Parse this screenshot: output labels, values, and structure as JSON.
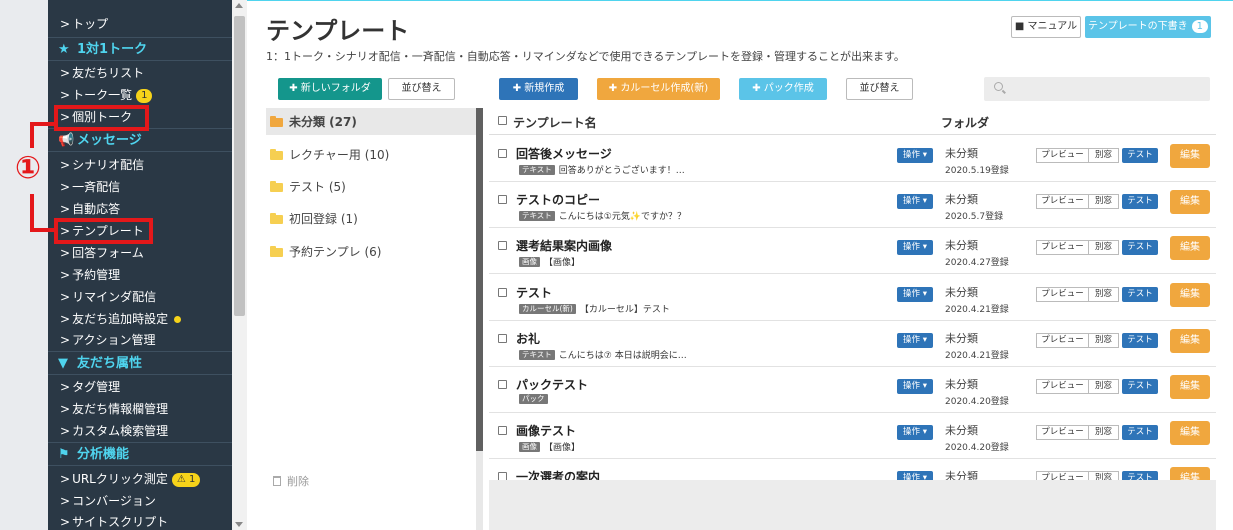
{
  "sidebar": {
    "items": [
      {
        "label": "トップ"
      },
      {
        "label": "1対1トーク",
        "heading": true,
        "icon": "star-icon"
      },
      {
        "label": "友だちリスト"
      },
      {
        "label": "トーク一覧",
        "badge": "1"
      },
      {
        "label": "個別トーク"
      },
      {
        "label": "メッセージ",
        "heading": true,
        "icon": "megaphone-icon"
      },
      {
        "label": "シナリオ配信"
      },
      {
        "label": "一斉配信"
      },
      {
        "label": "自動応答"
      },
      {
        "label": "テンプレート"
      },
      {
        "label": "回答フォーム"
      },
      {
        "label": "予約管理"
      },
      {
        "label": "リマインダ配信"
      },
      {
        "label": "友だち追加時設定"
      },
      {
        "label": "アクション管理"
      },
      {
        "label": "友だち属性",
        "heading": true,
        "icon": "filter-icon"
      },
      {
        "label": "タグ管理"
      },
      {
        "label": "友だち情報欄管理"
      },
      {
        "label": "カスタム検索管理"
      },
      {
        "label": "分析機能",
        "heading": true,
        "icon": "flag-icon"
      },
      {
        "label": "URLクリック測定",
        "warn_badge": "1"
      },
      {
        "label": "コンバージョン"
      },
      {
        "label": "サイトスクリプト"
      }
    ]
  },
  "annotation": {
    "number": "①"
  },
  "header": {
    "title": "テンプレート",
    "description": "1：1トーク・シナリオ配信・一斉配信・自動応答・リマインダなどで使用できるテンプレートを登録・管理することが出来ます。",
    "manual_label": "マニュアル",
    "draft_label": "テンプレートの下書き",
    "draft_count": "1"
  },
  "toolbar": {
    "new_folder": "新しいフォルダ",
    "sort_folders": "並び替え",
    "new_create": "新規作成",
    "carousel_create": "カルーセル作成(新)",
    "pack_create": "パック作成",
    "sort_templates": "並び替え",
    "search_placeholder": ""
  },
  "folders": [
    {
      "label": "未分類 (27)",
      "selected": true
    },
    {
      "label": "レクチャー用 (10)"
    },
    {
      "label": "テスト (5)"
    },
    {
      "label": "初回登録 (1)"
    },
    {
      "label": "予約テンプレ (6)"
    }
  ],
  "delete_label": "削除",
  "table": {
    "col_name": "テンプレート名",
    "col_folder": "フォルダ",
    "ops_label": "操作",
    "preview_label": "プレビュー",
    "new_window_label": "別窓",
    "test_label": "テスト",
    "edit_label": "編集",
    "rows": [
      {
        "name": "回答後メッセージ",
        "tag": "テキスト",
        "preview": "回答ありがとうございます！…",
        "folder": "未分類",
        "date": "2020.5.19登録"
      },
      {
        "name": "テストのコピー",
        "tag": "テキスト",
        "preview": "こんにちは①元気✨ですか？？",
        "folder": "未分類",
        "date": "2020.5.7登録"
      },
      {
        "name": "選考結果案内画像",
        "tag": "画像",
        "preview": "【画像】",
        "folder": "未分類",
        "date": "2020.4.27登録"
      },
      {
        "name": "テスト",
        "tag": "カルーセル(新)",
        "preview": "【カルーセル】テスト",
        "folder": "未分類",
        "date": "2020.4.21登録"
      },
      {
        "name": "お礼",
        "tag": "テキスト",
        "preview": "こんにちは⑦ 本日は説明会に…",
        "folder": "未分類",
        "date": "2020.4.21登録"
      },
      {
        "name": "パックテスト",
        "tag": "パック",
        "preview": "",
        "folder": "未分類",
        "date": "2020.4.20登録"
      },
      {
        "name": "画像テスト",
        "tag": "画像",
        "preview": "【画像】",
        "folder": "未分類",
        "date": "2020.4.20登録"
      },
      {
        "name": "一次選考の案内",
        "tag": "",
        "preview": "",
        "folder": "未分類",
        "date": ""
      }
    ]
  },
  "colors": {
    "sidebar_bg": "#2a3845",
    "heading": "#4fd4ee",
    "annotation_red": "#e4181a",
    "primary_blue": "#2e74b8",
    "teal": "#14968c",
    "orange": "#f0a73e",
    "light_blue": "#5bc4e8",
    "badge_yellow": "#f6d31a"
  }
}
